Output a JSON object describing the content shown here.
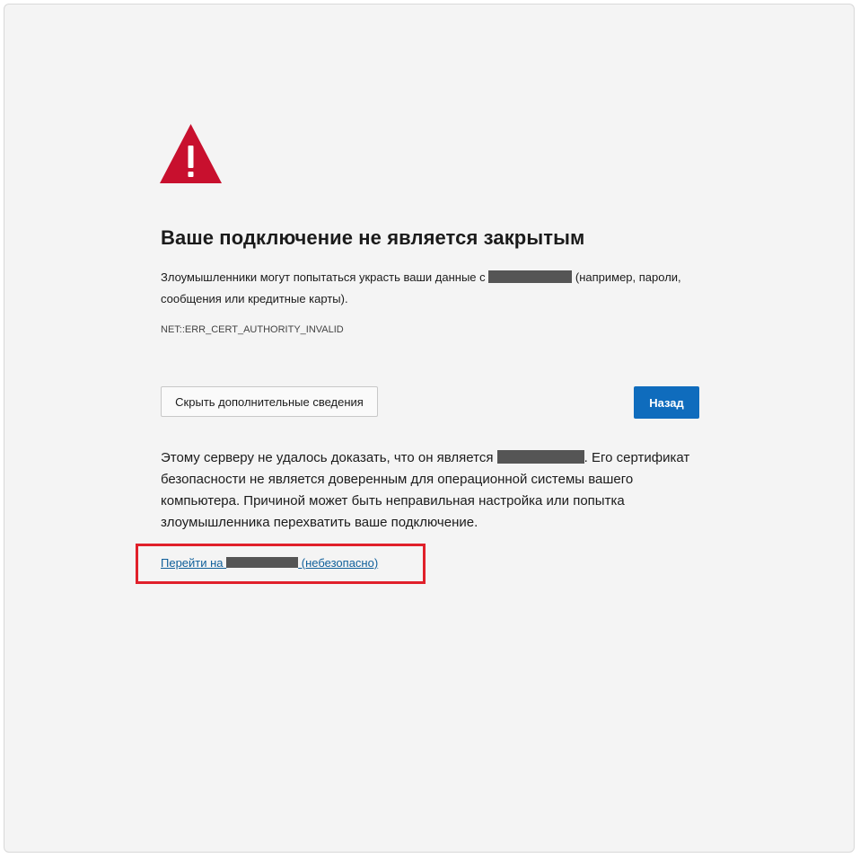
{
  "page": {
    "title": "Ваше подключение не является закрытым",
    "description_before": "Злоумышленники могут попытаться украсть ваши данные с ",
    "description_after": " (например, пароли, сообщения или кредитные карты).",
    "error_code": "NET::ERR_CERT_AUTHORITY_INVALID"
  },
  "buttons": {
    "details_label": "Скрыть дополнительные сведения",
    "back_label": "Назад"
  },
  "details": {
    "text_before": "Этому серверу не удалось доказать, что он является ",
    "text_after": ". Его сертификат безопасности не является доверенным для операционной системы вашего компьютера. Причиной может быть неправильная настройка или попытка злоумышленника перехватить ваше подключение.",
    "proceed_before": "Перейти на ",
    "proceed_after": " (небезопасно)"
  },
  "colors": {
    "background": "#f4f4f4",
    "warning_red": "#c8102e",
    "primary_button": "#0f6cbd",
    "link": "#0f5f9a",
    "highlight": "#e0202a",
    "redaction": "#555555"
  },
  "icons": {
    "warning": "warning-triangle-icon"
  }
}
